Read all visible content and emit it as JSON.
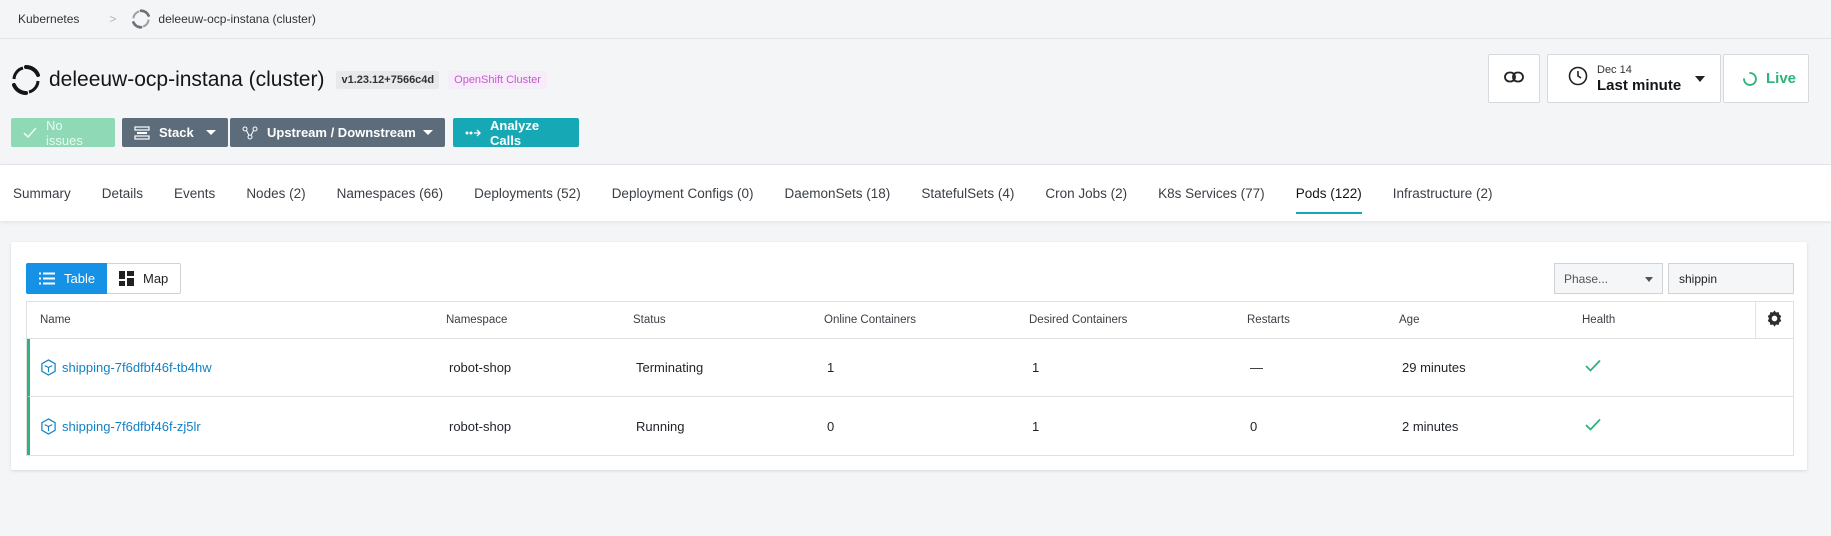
{
  "breadcrumb": {
    "root": "Kubernetes",
    "current": "deleeuw-ocp-instana (cluster)"
  },
  "header": {
    "title": "deleeuw-ocp-instana (cluster)",
    "version": "v1.23.12+7566c4d",
    "badge": "OpenShift Cluster"
  },
  "toolbar": {
    "no_issues": "No issues",
    "stack": "Stack",
    "upstream": "Upstream / Downstream",
    "analyze": "Analyze Calls"
  },
  "time": {
    "date": "Dec 14",
    "range": "Last minute",
    "live": "Live"
  },
  "tabs": [
    {
      "label": "Summary"
    },
    {
      "label": "Details"
    },
    {
      "label": "Events"
    },
    {
      "label": "Nodes (2)"
    },
    {
      "label": "Namespaces (66)"
    },
    {
      "label": "Deployments (52)"
    },
    {
      "label": "Deployment Configs (0)"
    },
    {
      "label": "DaemonSets (18)"
    },
    {
      "label": "StatefulSets (4)"
    },
    {
      "label": "Cron Jobs (2)"
    },
    {
      "label": "K8s Services (77)"
    },
    {
      "label": "Pods (122)"
    },
    {
      "label": "Infrastructure (2)"
    }
  ],
  "active_tab": "Pods (122)",
  "view": {
    "table": "Table",
    "map": "Map"
  },
  "filters": {
    "phase_placeholder": "Phase...",
    "search_value": "shippin"
  },
  "table": {
    "columns": [
      "Name",
      "Namespace",
      "Status",
      "Online Containers",
      "Desired Containers",
      "Restarts",
      "Age",
      "Health"
    ],
    "rows": [
      {
        "name": "shipping-7f6dfbf46f-tb4hw",
        "namespace": "robot-shop",
        "status": "Terminating",
        "online": "1",
        "desired": "1",
        "restarts": "—",
        "age": "29 minutes",
        "health": "✓"
      },
      {
        "name": "shipping-7f6dfbf46f-zj5lr",
        "namespace": "robot-shop",
        "status": "Running",
        "online": "0",
        "desired": "1",
        "restarts": "0",
        "age": "2 minutes",
        "health": "✓"
      }
    ]
  },
  "colors": {
    "accent": "#16a8b5",
    "healthy": "#2fb37a",
    "link": "#1481c6",
    "primary": "#1592e6"
  }
}
